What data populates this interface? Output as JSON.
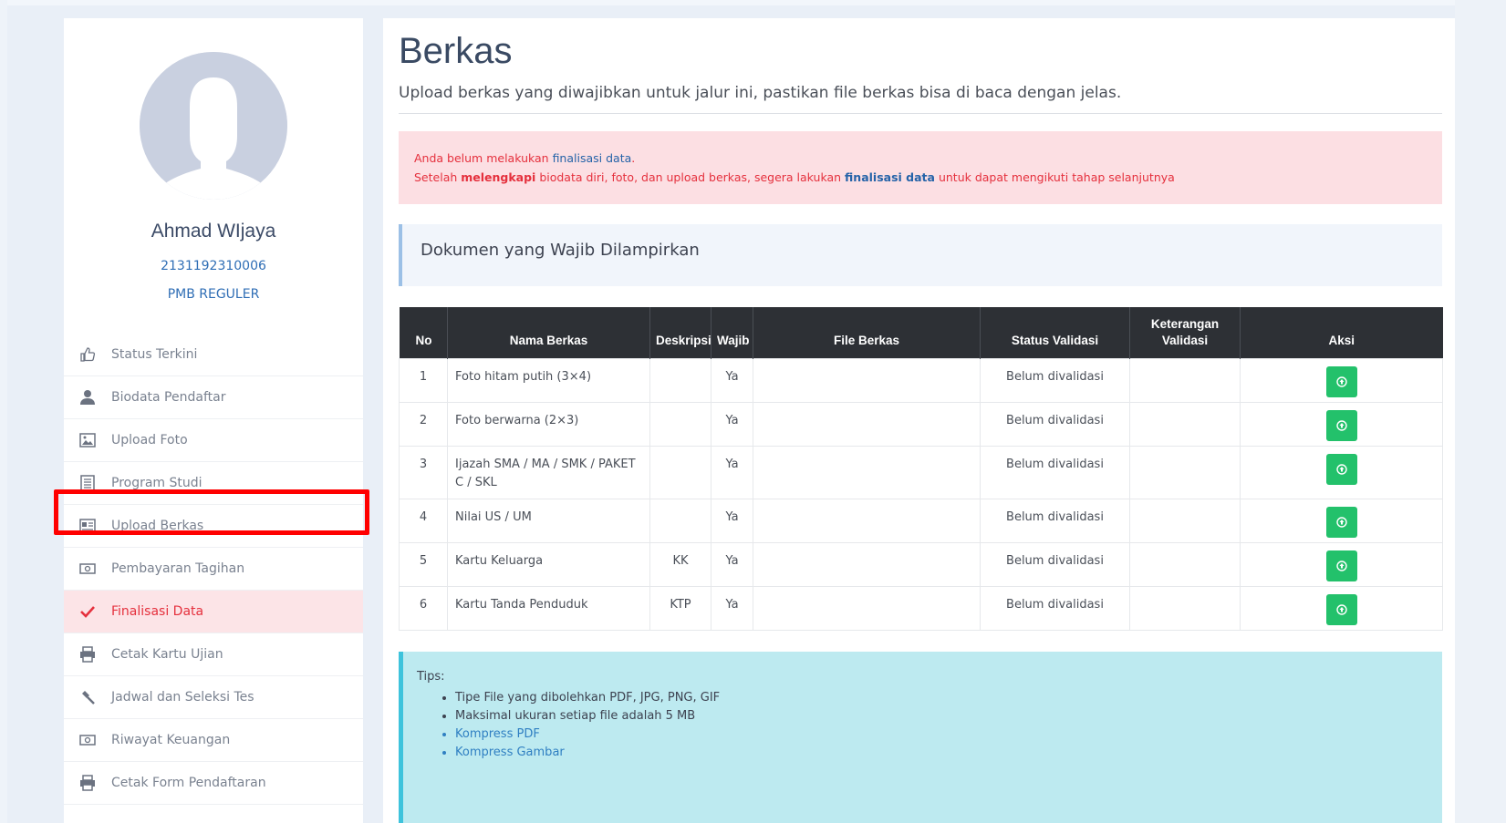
{
  "profile": {
    "name": "Ahmad WIjaya",
    "id_number": "2131192310006",
    "program": "PMB REGULER"
  },
  "sidebar": {
    "items": [
      {
        "label": "Status Terkini",
        "icon": "thumbs-up-icon",
        "active": false
      },
      {
        "label": "Biodata Pendaftar",
        "icon": "user-icon",
        "active": false
      },
      {
        "label": "Upload Foto",
        "icon": "image-icon",
        "active": false
      },
      {
        "label": "Program Studi",
        "icon": "list-icon",
        "active": false
      },
      {
        "label": "Upload Berkas",
        "icon": "id-card-icon",
        "active": false,
        "highlighted": true
      },
      {
        "label": "Pembayaran Tagihan",
        "icon": "money-icon",
        "active": false
      },
      {
        "label": "Finalisasi Data",
        "icon": "checkmark-icon",
        "active": true
      },
      {
        "label": "Cetak Kartu Ujian",
        "icon": "printer-icon",
        "active": false
      },
      {
        "label": "Jadwal dan Seleksi Tes",
        "icon": "gavel-icon",
        "active": false
      },
      {
        "label": "Riwayat Keuangan",
        "icon": "money-icon",
        "active": false
      },
      {
        "label": "Cetak Form Pendaftaran",
        "icon": "printer-icon",
        "active": false
      }
    ]
  },
  "main": {
    "title": "Berkas",
    "subtitle": "Upload berkas yang diwajibkan untuk jalur ini, pastikan file berkas bisa di baca dengan jelas.",
    "alert": {
      "line1_prefix": "Anda belum melakukan ",
      "line1_link": "finalisasi data",
      "line1_suffix": ".",
      "line2_a": "Setelah ",
      "line2_bold": "melengkapi",
      "line2_b": " biodata diri, foto, dan upload berkas, segera lakukan ",
      "line2_link": "finalisasi data",
      "line2_c": " untuk dapat mengikuti tahap selanjutnya"
    },
    "doc_heading": "Dokumen yang Wajib Dilampirkan",
    "table": {
      "headers": [
        "No",
        "Nama Berkas",
        "Deskripsi",
        "Wajib",
        "File Berkas",
        "Status Validasi",
        "Keterangan Validasi",
        "Aksi"
      ],
      "rows": [
        {
          "no": "1",
          "nama": "Foto hitam putih (3×4)",
          "deskripsi": "",
          "wajib": "Ya",
          "file": "",
          "status": "Belum divalidasi",
          "keterangan": ""
        },
        {
          "no": "2",
          "nama": "Foto berwarna (2×3)",
          "deskripsi": "",
          "wajib": "Ya",
          "file": "",
          "status": "Belum divalidasi",
          "keterangan": ""
        },
        {
          "no": "3",
          "nama": "Ijazah SMA / MA / SMK / PAKET C / SKL",
          "deskripsi": "",
          "wajib": "Ya",
          "file": "",
          "status": "Belum divalidasi",
          "keterangan": ""
        },
        {
          "no": "4",
          "nama": "Nilai US / UM",
          "deskripsi": "",
          "wajib": "Ya",
          "file": "",
          "status": "Belum divalidasi",
          "keterangan": ""
        },
        {
          "no": "5",
          "nama": "Kartu Keluarga",
          "deskripsi": "KK",
          "wajib": "Ya",
          "file": "",
          "status": "Belum divalidasi",
          "keterangan": ""
        },
        {
          "no": "6",
          "nama": "Kartu Tanda Penduduk",
          "deskripsi": "KTP",
          "wajib": "Ya",
          "file": "",
          "status": "Belum divalidasi",
          "keterangan": ""
        }
      ]
    },
    "tips": {
      "heading": "Tips:",
      "items": [
        "Tipe File yang dibolehkan PDF, JPG, PNG, GIF",
        "Maksimal ukuran setiap file adalah 5 MB",
        "Kompress PDF",
        "Kompress Gambar"
      ]
    }
  },
  "colors": {
    "accent_blue": "#2f6eb5",
    "alert_red": "#e5303d",
    "action_green": "#23c16b",
    "table_header": "#2d3035"
  }
}
